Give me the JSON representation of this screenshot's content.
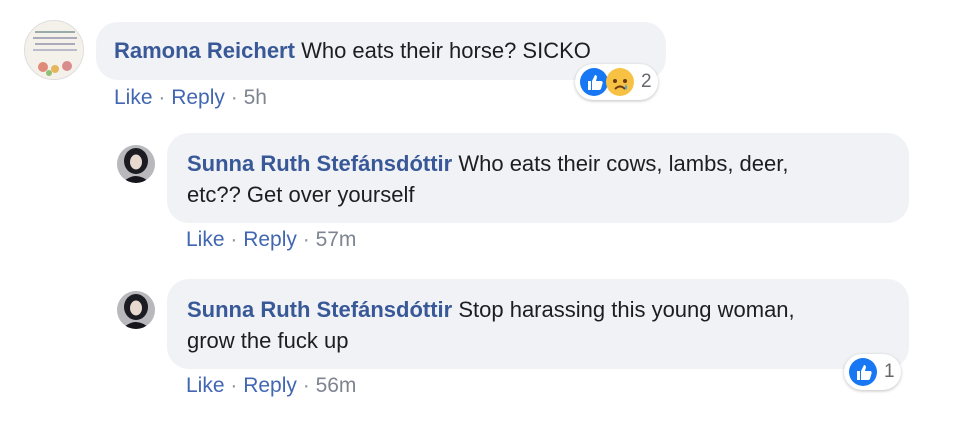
{
  "comments": [
    {
      "author": "Ramona Reichert",
      "text": "Who eats their horse? SICKO",
      "actions": {
        "like": "Like",
        "reply": "Reply",
        "sep": " · ",
        "time": "5h"
      },
      "reactions": {
        "icons": [
          "like-icon",
          "sad-icon"
        ],
        "count": "2"
      }
    },
    {
      "author": "Sunna Ruth Stefánsdóttir",
      "text_line1": "Who eats their cows, lambs, deer,",
      "text_line2": "etc?? Get over yourself",
      "actions": {
        "like": "Like",
        "reply": "Reply",
        "sep": " · ",
        "time": "57m"
      }
    },
    {
      "author": "Sunna Ruth Stefánsdóttir",
      "text_line1": "Stop harassing this young woman,",
      "text_line2": "grow the fuck up",
      "actions": {
        "like": "Like",
        "reply": "Reply",
        "sep": " · ",
        "time": "56m"
      },
      "reactions": {
        "icons": [
          "like-icon"
        ],
        "count": "1"
      }
    }
  ],
  "colors": {
    "author": "#385898",
    "link": "#4267b2",
    "bubble": "#f0f2f5",
    "like_blue": "#1877f2"
  }
}
